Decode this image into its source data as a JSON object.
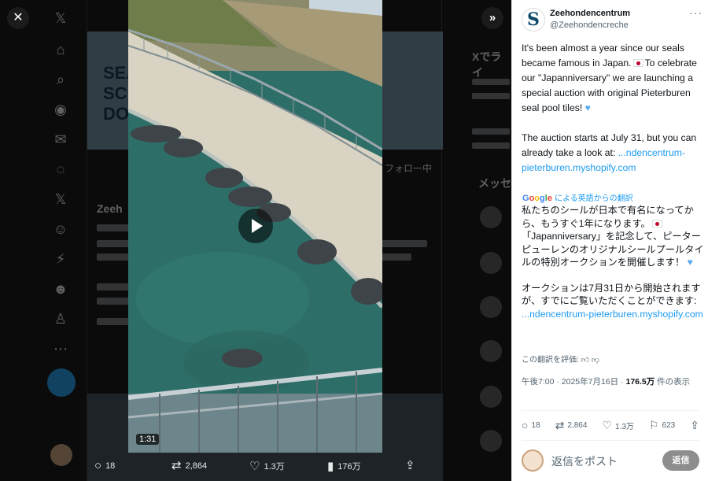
{
  "video": {
    "duration": "1:31"
  },
  "media_bar": {
    "replies": "18",
    "reposts": "2,864",
    "likes": "1.3万",
    "views": "176万"
  },
  "post": {
    "author_name": "Zeehondencentrum",
    "author_handle": "@Zeehondencreche",
    "avatar_letter": "S",
    "text_en_1": "It's been almost a year since our seals became famous in Japan.",
    "text_en_2": "To celebrate our \"Japanniversary\" we are launching a special auction with original Pieterburen seal pool tiles!",
    "text_en_3": "The auction starts at July 31, but you can already take a look at:",
    "link_1": "...ndencentrum-pieterburen.myshopify.com",
    "translation_note": "による英語からの翻訳",
    "translation_brand": "Google",
    "text_jp_1": "私たちのシールが日本で有名になってから、もうすぐ1年になります。",
    "text_jp_2": "「Japanniversary」を記念して、ピーターピューレンのオリジナルシールプールタイルの特別オークションを開催します！",
    "text_jp_3": "オークションは7月31日から開始されますが、すでにご覧いただくことができます:",
    "link_2": "...ndencentrum-pieterburen.myshopify.com",
    "rate_label": "この翻訳を評価:",
    "time": "午後7:00 · 2025年7月16日 · ",
    "views_count": "176.5万",
    "views_label": " 件の表示"
  },
  "stats": {
    "replies": "18",
    "reposts": "2,864",
    "likes": "1.3万",
    "bookmarks": "623"
  },
  "reply": {
    "placeholder": "返信をポスト",
    "button_label": "返信"
  },
  "background": {
    "banner_text": "SEA\nSCI\nDO",
    "follow_label": "フォロー中",
    "name": "Zeeh",
    "right_heading": "Xでライ",
    "messages_heading": "メッセ"
  },
  "colors": {
    "accent": "#1d9bf0",
    "reply_button": "#8e8e8e",
    "pool_water": "#2e6e68"
  }
}
